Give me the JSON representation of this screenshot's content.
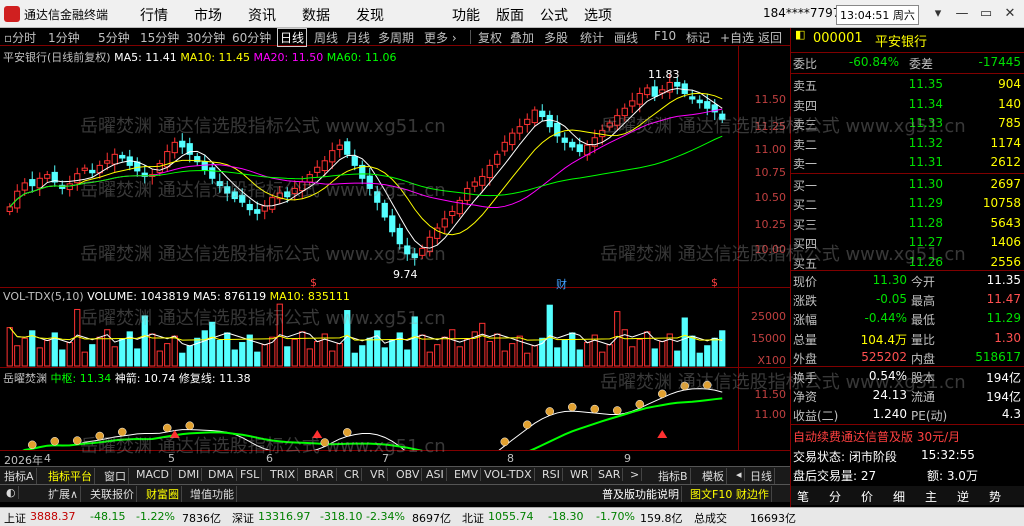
{
  "titlebar": {
    "title": "通达信金融终端",
    "menu": [
      "行情",
      "市场",
      "资讯",
      "数据",
      "发现",
      "功能",
      "版面",
      "公式",
      "选项"
    ],
    "user": "184****7797",
    "clock": "13:04:51 周六",
    "buttons": [
      "▾",
      "—",
      "▭",
      "✕"
    ]
  },
  "toolbar": {
    "items": [
      "分时",
      "1分钟",
      "5分钟",
      "15分钟",
      "30分钟",
      "60分钟",
      "日线",
      "周线",
      "月线",
      "多周期",
      "更多",
      "复权",
      "叠加",
      "多股",
      "统计",
      "画线",
      "F10",
      "标记",
      "+自选",
      "返回"
    ],
    "active": "日线"
  },
  "main_chart": {
    "label": "平安银行(日线前复权)",
    "ma": [
      {
        "text": "MA5: 11.41",
        "color": "#ffffff"
      },
      {
        "text": "MA10: 11.45",
        "color": "#ffff00"
      },
      {
        "text": "MA20: 11.50",
        "color": "#ff00ff"
      },
      {
        "text": "MA60: 11.06",
        "color": "#00ff00"
      }
    ],
    "yticks": [
      "11.50",
      "11.25",
      "11.00",
      "10.75",
      "10.50",
      "10.25",
      "10.00"
    ],
    "high_label": "11.83",
    "low_label": "9.74",
    "markers": [
      "$",
      "财",
      "$"
    ]
  },
  "volume_chart": {
    "label": "VOL-TDX(5,10)",
    "volume": "VOLUME: 1043819",
    "ma5": "MA5: 876119",
    "ma10": "MA10: 835111",
    "yticks": [
      "25000",
      "15000",
      "5000"
    ],
    "unit": "X100"
  },
  "indicator_chart": {
    "label": "岳曜焚渊",
    "items": [
      {
        "text": "中枢: 11.34",
        "color": "#00ff00"
      },
      {
        "text": "神箭: 10.74",
        "color": "#ffffff"
      },
      {
        "text": "修复线: 11.38",
        "color": "#ffffff"
      }
    ],
    "yticks": [
      "11.50",
      "11.00"
    ]
  },
  "date_axis": [
    "2026年",
    "4",
    "5",
    "6",
    "7",
    "8",
    "9"
  ],
  "tabs1": [
    "指标A",
    "指标平台",
    "窗口",
    "MACD",
    "DMI",
    "DMA",
    "FSL",
    "TRIX",
    "BRAR",
    "CR",
    "VR",
    "OBV",
    "ASI",
    "EMV",
    "VOL-TDX",
    "RSI",
    "WR",
    "SAR",
    ">",
    "指标B",
    "模板",
    "◂",
    "日线"
  ],
  "tabs2": [
    "扩展∧",
    "关联报价",
    "财富圈",
    "增值功能"
  ],
  "right_panel": {
    "code": "000001",
    "name": "平安银行",
    "weibi_label": "委比",
    "weibi_val": "-60.84%",
    "weicha_label": "委差",
    "weicha_val": "-17445",
    "asks": [
      {
        "k": "卖五",
        "p": "11.35",
        "v": "904"
      },
      {
        "k": "卖四",
        "p": "11.34",
        "v": "140"
      },
      {
        "k": "卖三",
        "p": "11.33",
        "v": "785"
      },
      {
        "k": "卖二",
        "p": "11.32",
        "v": "1174"
      },
      {
        "k": "卖一",
        "p": "11.31",
        "v": "2612"
      }
    ],
    "bids": [
      {
        "k": "买一",
        "p": "11.30",
        "v": "2697"
      },
      {
        "k": "买二",
        "p": "11.29",
        "v": "10758"
      },
      {
        "k": "买三",
        "p": "11.28",
        "v": "5643"
      },
      {
        "k": "买四",
        "p": "11.27",
        "v": "1406"
      },
      {
        "k": "买五",
        "p": "11.26",
        "v": "2556"
      }
    ],
    "stats": [
      {
        "k1": "现价",
        "v1": "11.30",
        "k2": "今开",
        "v2": "11.35",
        "c1": "grn",
        "c2": "wht"
      },
      {
        "k1": "涨跌",
        "v1": "-0.05",
        "k2": "最高",
        "v2": "11.47",
        "c1": "grn",
        "c2": "red"
      },
      {
        "k1": "涨幅",
        "v1": "-0.44%",
        "k2": "最低",
        "v2": "11.29",
        "c1": "grn",
        "c2": "grn"
      },
      {
        "k1": "总量",
        "v1": "104.4万",
        "k2": "量比",
        "v2": "1.30",
        "c1": "yel",
        "c2": "red"
      },
      {
        "k1": "外盘",
        "v1": "525202",
        "k2": "内盘",
        "v2": "518617",
        "c1": "red",
        "c2": "grn"
      }
    ],
    "stats2": [
      {
        "k1": "换手",
        "v1": "0.54%",
        "k2": "股本",
        "v2": "194亿",
        "c1": "wht",
        "c2": "wht"
      },
      {
        "k1": "净资",
        "v1": "24.13",
        "k2": "流通",
        "v2": "194亿",
        "c1": "wht",
        "c2": "wht"
      },
      {
        "k1": "收益(二)",
        "v1": "1.240",
        "k2": "PE(动)",
        "v2": "4.3",
        "c1": "wht",
        "c2": "wht"
      }
    ],
    "promo": "自动续费通达信普及版 30元/月",
    "trade_status": "交易状态: 闭市阶段",
    "trade_time": "15:32:55",
    "after_vol": "盘后交易量: 27",
    "after_amt": "额: 3.0万",
    "btns": [
      "笔",
      "分",
      "价",
      "细",
      "主",
      "逆",
      "势"
    ]
  },
  "statusbar": {
    "sh_label": "上证",
    "sh_val": "3888.37",
    "sh_chg": "-48.15",
    "sh_pct": "-1.22%",
    "sh_amt": "7836亿",
    "sz_label": "深证",
    "sz_val": "13316.97",
    "sz_chg": "-318.10",
    "sz_pct": "-2.34%",
    "sz_amt": "8697亿",
    "bz_label": "北证",
    "bz_val": "1055.74",
    "bz_chg": "-18.30",
    "bz_pct": "-1.70%",
    "bz_amt": "159.8亿",
    "total_label": "总成交",
    "total_val": "16693亿",
    "links": [
      "普及版功能说明",
      "图文F10 财边作"
    ]
  },
  "watermark": "岳曜焚渊 通达信选股指标公式 www.xg51.cn",
  "chart_data": {
    "type": "candlestick",
    "title": "平安银行(日线前复权)",
    "ylim": [
      9.6,
      11.9
    ],
    "x": [
      "4",
      "5",
      "6",
      "7",
      "8",
      "9"
    ],
    "series": [
      {
        "name": "MA5",
        "value": 11.41
      },
      {
        "name": "MA10",
        "value": 11.45
      },
      {
        "name": "MA20",
        "value": 11.5
      },
      {
        "name": "MA60",
        "value": 11.06
      }
    ],
    "high": 11.83,
    "low": 9.74,
    "closes": [
      10.35,
      10.52,
      10.61,
      10.58,
      10.66,
      10.7,
      10.62,
      10.55,
      10.6,
      10.71,
      10.77,
      10.72,
      10.8,
      10.85,
      10.92,
      10.88,
      10.8,
      10.74,
      10.68,
      10.7,
      10.82,
      10.95,
      11.05,
      11.0,
      10.92,
      10.84,
      10.75,
      10.66,
      10.58,
      10.5,
      10.44,
      10.4,
      10.32,
      10.28,
      10.36,
      10.45,
      10.5,
      10.46,
      10.55,
      10.62,
      10.7,
      10.78,
      10.85,
      10.96,
      11.02,
      10.92,
      10.8,
      10.66,
      10.55,
      10.4,
      10.24,
      10.08,
      9.95,
      9.84,
      9.8,
      9.9,
      10.02,
      10.12,
      10.22,
      10.3,
      10.42,
      10.55,
      10.62,
      10.68,
      10.8,
      10.92,
      11.05,
      11.15,
      11.22,
      11.3,
      11.4,
      11.33,
      11.22,
      11.12,
      11.05,
      11.0,
      10.95,
      11.02,
      11.1,
      11.18,
      11.26,
      11.34,
      11.42,
      11.5,
      11.58,
      11.64,
      11.55,
      11.62,
      11.7,
      11.66,
      11.58,
      11.52,
      11.48,
      11.42,
      11.38,
      11.3
    ]
  }
}
